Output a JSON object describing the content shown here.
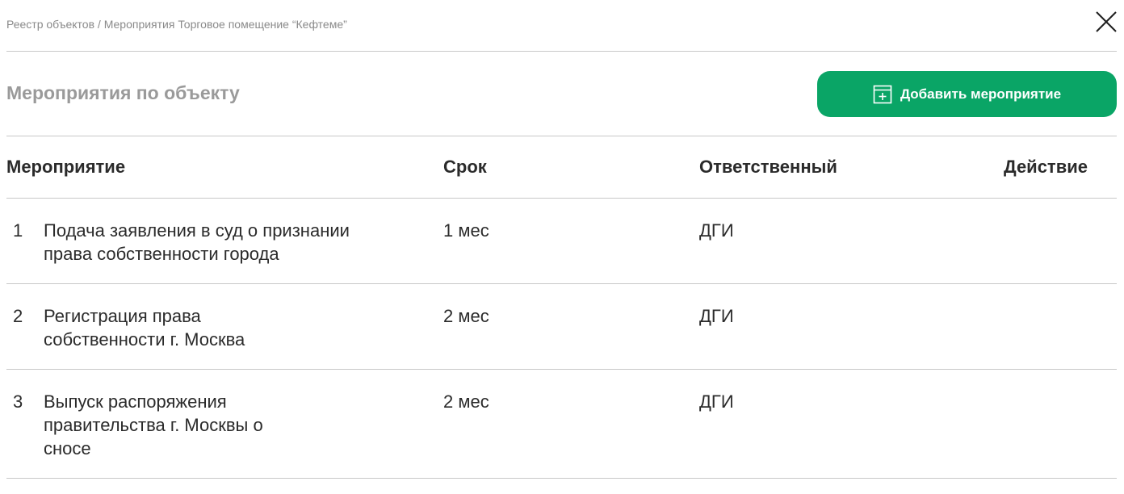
{
  "breadcrumb": "Реестр объектов / Мероприятия Торговое помещение “Кефтеме”",
  "section_title": "Мероприятия по объекту",
  "add_button": {
    "label": "Добавить мероприятие",
    "icon": "calendar-plus-icon",
    "color": "#0aa566"
  },
  "close_icon": "close-icon",
  "table": {
    "headers": {
      "event": "Мероприятие",
      "term": "Срок",
      "responsible": "Ответственный",
      "action": "Действие"
    },
    "rows": [
      {
        "num": "1",
        "title_lines": [
          "Подача заявления в суд о признании",
          "права собственности города"
        ],
        "term": "1 мес",
        "responsible": "ДГИ"
      },
      {
        "num": "2",
        "title_lines": [
          "Регистрация права",
          "собственности г. Москва"
        ],
        "term": "2 мес",
        "responsible": "ДГИ"
      },
      {
        "num": "3",
        "title_lines": [
          "Выпуск распоряжения",
          "правительства г. Москвы о",
          "сносе"
        ],
        "term": "2 мес",
        "responsible": "ДГИ"
      }
    ]
  }
}
